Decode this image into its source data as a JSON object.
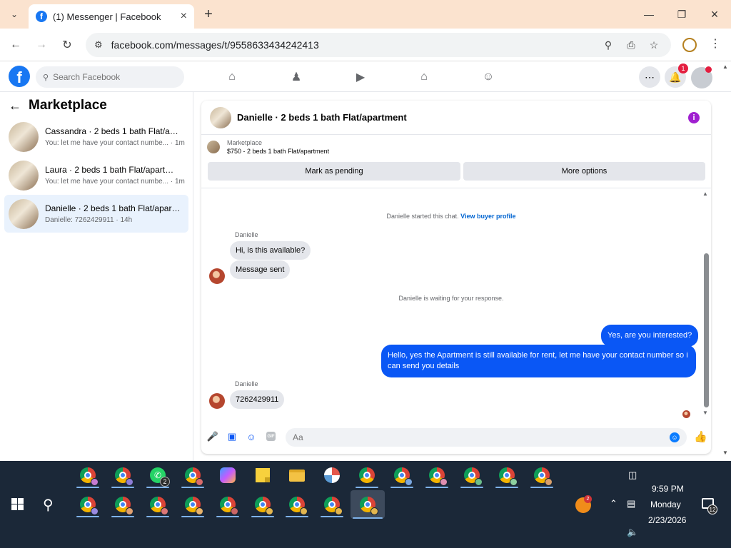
{
  "browser": {
    "tab_title": "(1) Messenger | Facebook",
    "url": "facebook.com/messages/t/9558633434242413"
  },
  "fb_header": {
    "search_placeholder": "Search Facebook",
    "notification_count": "1"
  },
  "sidebar": {
    "title": "Marketplace",
    "conversations": [
      {
        "title": "Cassandra · 2 beds 1 bath Flat/apa...",
        "subtitle": "You: let me have your contact numbe... · 1m",
        "active": false
      },
      {
        "title": "Laura · 2 beds 1 bath Flat/apartment",
        "subtitle": "You: let me have your contact numbe... · 1m",
        "active": false
      },
      {
        "title": "Danielle · 2 beds 1 bath Flat/apart...",
        "subtitle": "Danielle: 7262429911 · 14h",
        "active": true
      }
    ]
  },
  "chat": {
    "header_title": "Danielle · 2 beds 1 bath Flat/apartment",
    "listing_label": "Marketplace",
    "listing_detail": "$750 - 2 beds 1 bath Flat/apartment",
    "mark_pending_label": "Mark as pending",
    "more_options_label": "More options",
    "started_text": "Danielle started this chat.",
    "view_profile_label": "View buyer profile",
    "waiting_text": "Danielle is waiting for your response.",
    "sender_name": "Danielle",
    "incoming_1": "Hi, is this available?",
    "incoming_2": "Message sent",
    "outgoing_1": "Yes, are you interested?",
    "outgoing_2": "Hello, yes the Apartment is still available for rent, let me have your contact number so i can send you details",
    "incoming_3": "7262429911",
    "composer_placeholder": "Aa",
    "gif_label": "GIF"
  },
  "taskbar": {
    "whatsapp_badge": "2",
    "tray_badge": "2",
    "time": "9:59 PM",
    "day": "Monday",
    "date": "2/23/2026",
    "notification_count": "12"
  },
  "colors": {
    "tab_strip": "#fbe3cf",
    "fb_blue": "#1877f2",
    "outgoing_bubble": "#0a57f5",
    "taskbar": "#1b2838"
  }
}
